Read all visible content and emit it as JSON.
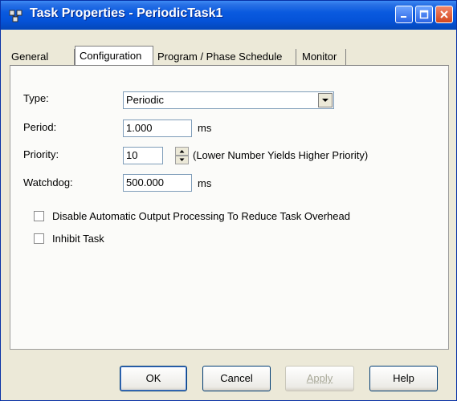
{
  "window": {
    "title": "Task Properties - PeriodicTask1"
  },
  "tabs": [
    {
      "label": "General"
    },
    {
      "label": "Configuration",
      "active": true
    },
    {
      "label": "Program / Phase Schedule"
    },
    {
      "label": "Monitor"
    }
  ],
  "form": {
    "type_label": "Type:",
    "type_value": "Periodic",
    "period_label": "Period:",
    "period_value": "1.000",
    "period_unit": "ms",
    "priority_label": "Priority:",
    "priority_value": "10",
    "priority_hint": "(Lower Number Yields Higher Priority)",
    "watchdog_label": "Watchdog:",
    "watchdog_value": "500.000",
    "watchdog_unit": "ms",
    "disable_output_label": "Disable Automatic Output Processing To Reduce Task Overhead",
    "disable_output_checked": false,
    "inhibit_label": "Inhibit Task",
    "inhibit_checked": false
  },
  "buttons": {
    "ok": "OK",
    "cancel": "Cancel",
    "apply": "Apply",
    "help": "Help"
  },
  "colors": {
    "titlebar": "#0553d8",
    "dialog": "#ece9d8",
    "panel": "#fbfbf9",
    "close": "#d2461d"
  }
}
